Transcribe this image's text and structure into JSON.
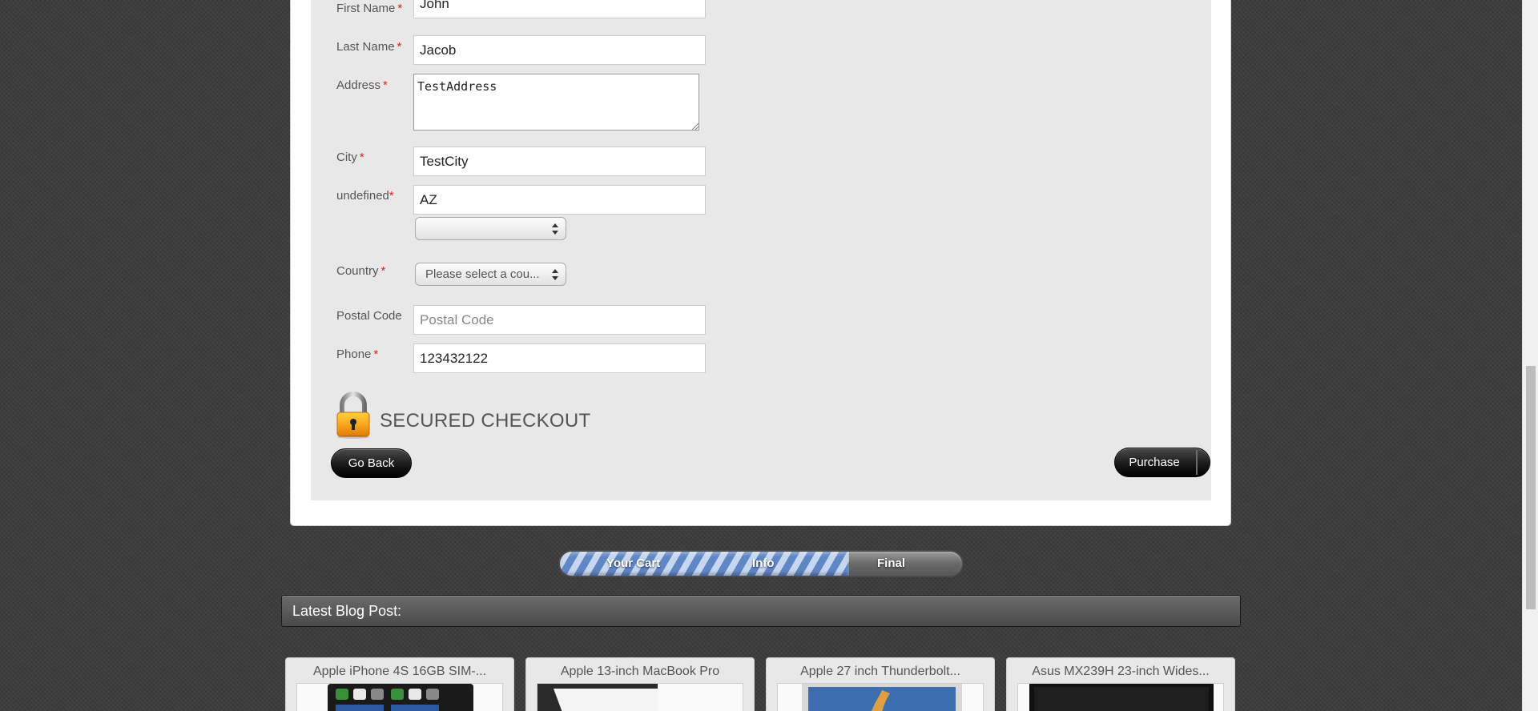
{
  "form": {
    "first_name": {
      "label": "First Name",
      "required_mark": "*",
      "value": "John"
    },
    "last_name": {
      "label": "Last Name",
      "required_mark": "*",
      "value": "Jacob"
    },
    "address": {
      "label": "Address",
      "required_mark": "*",
      "value": "TestAddress"
    },
    "city": {
      "label": "City",
      "required_mark": "*",
      "value": "TestCity"
    },
    "state": {
      "label": "undefined",
      "required_mark": "*",
      "value": "AZ",
      "select_value": ""
    },
    "country": {
      "label": "Country",
      "required_mark": "*",
      "selected": "Please select a cou..."
    },
    "postal_code": {
      "label": "Postal Code",
      "placeholder": "Postal Code",
      "value": ""
    },
    "phone": {
      "label": "Phone",
      "required_mark": "*",
      "value": "123432122"
    }
  },
  "checkout": {
    "secure_title": "SECURED CHECKOUT",
    "lock_icon": "padlock-icon",
    "go_back_label": "Go Back",
    "purchase_label": "Purchase"
  },
  "progress": {
    "steps": [
      "Your Cart",
      "Info",
      "Final"
    ],
    "fill_fraction": 0.72,
    "fill_color": "#5f86c5"
  },
  "blog": {
    "header": "Latest Blog Post:",
    "posts": [
      {
        "title": "Apple iPhone 4S 16GB SIM-..."
      },
      {
        "title": "Apple 13-inch MacBook Pro"
      },
      {
        "title": "Apple 27 inch Thunderbolt..."
      },
      {
        "title": "Asus MX239H 23-inch Wides..."
      }
    ]
  },
  "colors": {
    "required": "#e02020",
    "panel": "#e8e8e8",
    "page_background": "#3b3b3b"
  }
}
